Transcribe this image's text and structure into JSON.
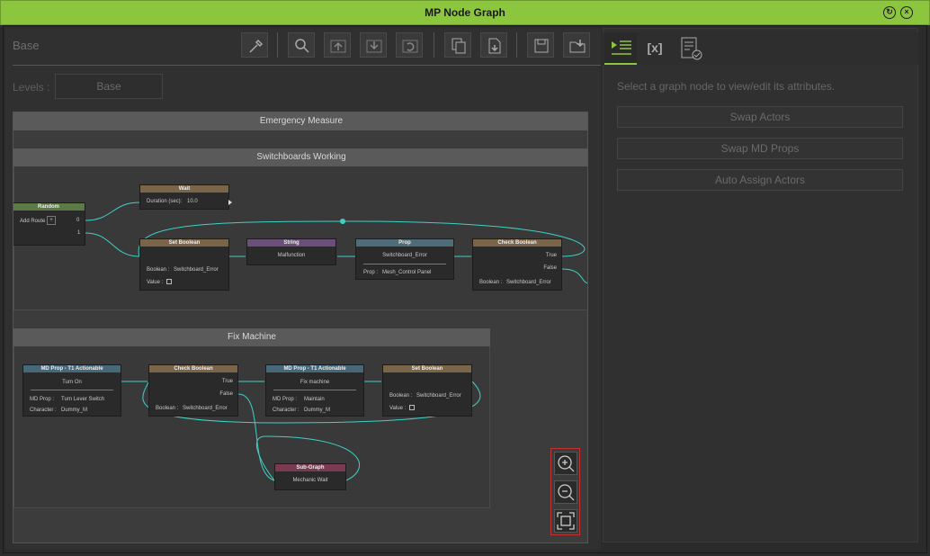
{
  "window": {
    "title": "MP Node Graph"
  },
  "breadcrumb": {
    "base": "Base"
  },
  "levels": {
    "label": "Levels :",
    "value": "Base"
  },
  "groups": {
    "emergency": "Emergency Measure",
    "switchboards": "Switchboards Working",
    "fix": "Fix Machine"
  },
  "nodes": {
    "wait": {
      "title": "Wait",
      "duration_label": "Duration (sec):",
      "duration_value": "10.0"
    },
    "random": {
      "title": "Random",
      "add_route": "Add Route",
      "out0": "0",
      "out1": "1"
    },
    "setbool1": {
      "title": "Set Boolean",
      "boolean_label": "Boolean :",
      "boolean_value": "Switchboard_Error",
      "value_label": "Value :"
    },
    "string": {
      "title": "String",
      "value": "Malfunction"
    },
    "prop": {
      "title": "Prop",
      "name": "Switchboard_Error",
      "prop_label": "Prop :",
      "prop_value": "Mesh_Control Panel"
    },
    "checkbool1": {
      "title": "Check Boolean",
      "true": "True",
      "false": "False",
      "boolean_label": "Boolean :",
      "boolean_value": "Switchboard_Error"
    },
    "md1": {
      "title": "MD Prop - T1 Actionable",
      "action": "Turn On",
      "mdprop_label": "MD Prop :",
      "mdprop_value": "Turn Lever Switch",
      "char_label": "Character :",
      "char_value": "Dummy_M"
    },
    "checkbool2": {
      "title": "Check Boolean",
      "true": "True",
      "false": "False",
      "boolean_label": "Boolean :",
      "boolean_value": "Switchboard_Error"
    },
    "md2": {
      "title": "MD Prop - T1 Actionable",
      "action": "Fix machine",
      "mdprop_label": "MD Prop :",
      "mdprop_value": "Maintain",
      "char_label": "Character :",
      "char_value": "Dummy_M"
    },
    "setbool2": {
      "title": "Set Boolean",
      "boolean_label": "Boolean :",
      "boolean_value": "Switchboard_Error",
      "value_label": "Value :"
    },
    "subgraph": {
      "title": "Sub-Graph",
      "name": "Mechanic Wait"
    }
  },
  "inspector": {
    "hint": "Select a graph node to view/edit its attributes.",
    "buttons": [
      "Swap Actors",
      "Swap MD Props",
      "Auto Assign Actors"
    ],
    "tab2_glyph": "[x]"
  },
  "colors": {
    "accent": "#8cc63f",
    "wire": "#3fd1c4",
    "highlight": "#c0312f"
  }
}
